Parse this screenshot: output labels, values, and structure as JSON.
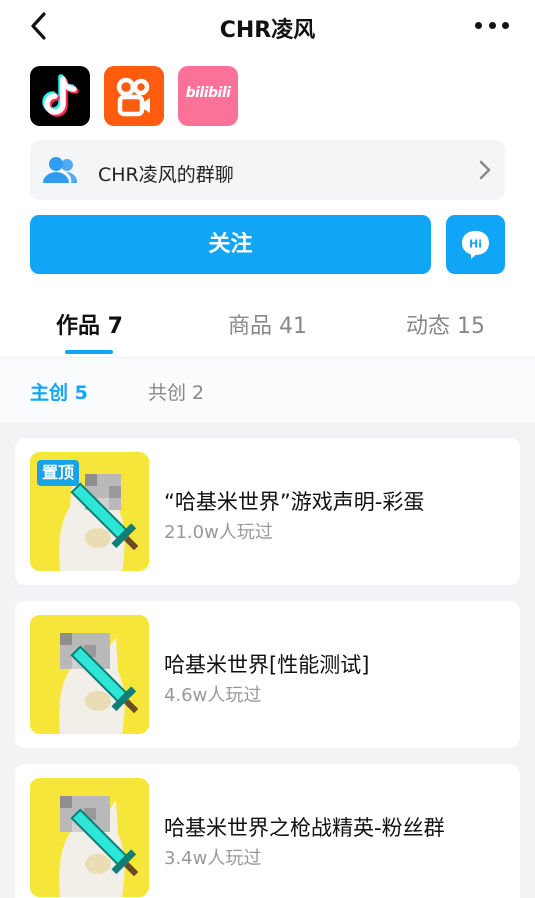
{
  "header": {
    "title": "CHR凌风"
  },
  "platforms": {
    "bilibili_text": "bilibili"
  },
  "group": {
    "label": "CHR凌风的群聊"
  },
  "actions": {
    "follow_label": "关注",
    "hi_label": "Hi"
  },
  "tabs": [
    {
      "label": "作品 7",
      "active": true
    },
    {
      "label": "商品 41",
      "active": false
    },
    {
      "label": "动态 15",
      "active": false
    }
  ],
  "subtabs": [
    {
      "label": "主创 5",
      "active": true
    },
    {
      "label": "共创 2",
      "active": false
    }
  ],
  "works": [
    {
      "title": "“哈基米世界”游戏声明-彩蛋",
      "plays": "21.0w人玩过",
      "badge": "置顶"
    },
    {
      "title": "哈基米世界[性能测试]",
      "plays": "4.6w人玩过"
    },
    {
      "title": "哈基米世界之枪战精英-粉丝群",
      "plays": "3.4w人玩过"
    }
  ],
  "colors": {
    "accent": "#11a5f8",
    "thumb_bg": "#f7e63a",
    "kuaishou": "#ff5c0f",
    "bilibili": "#fb7299"
  }
}
